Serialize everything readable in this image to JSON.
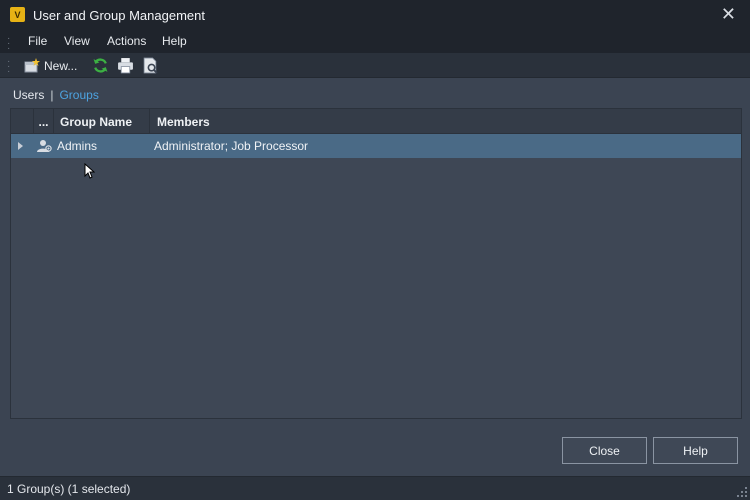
{
  "window": {
    "title": "User and Group Management",
    "app_icon_letter": "V"
  },
  "menu": {
    "items": [
      "File",
      "View",
      "Actions",
      "Help"
    ]
  },
  "toolbar": {
    "new_label": "New..."
  },
  "tabs": {
    "users": "Users",
    "separator": "|",
    "groups": "Groups",
    "active": "Groups"
  },
  "grid": {
    "columns": [
      "...",
      "Group Name",
      "Members"
    ],
    "rows": [
      {
        "name": "Admins",
        "members": "Administrator; Job Processor",
        "selected": true
      }
    ]
  },
  "buttons": {
    "close": "Close",
    "help": "Help"
  },
  "status": {
    "text": "1 Group(s) (1 selected)"
  },
  "colors": {
    "accent": "#4da3e0",
    "selection": "#4a6a86",
    "refresh": "#3cb043"
  }
}
